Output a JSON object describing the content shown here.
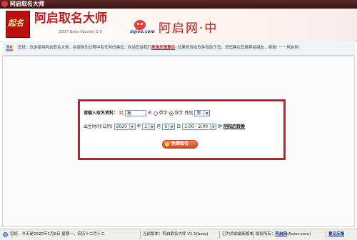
{
  "window": {
    "title": "阿启取名大师"
  },
  "banner": {
    "logo_text": "起名",
    "brand_title": "阿启取名大师",
    "version": "2007 Beta Version 1.0",
    "site_logo_text": "aqioo.com",
    "site_name": "阿启网·中"
  },
  "welcome": {
    "text": "您好，欢迎使用阿启取名大师，在使用的过程中有任何的建议，欢迎您给我们",
    "link": "来信反馈意见",
    "text_after": "! 如果觉得本软件有助于您，请您建议您推荐给朋友，谢谢! 一一阿启网"
  },
  "form": {
    "prompt": "请输入取名资料：",
    "surname_label": "姓",
    "surname_value": "杨",
    "name_label": "名",
    "single_char": "单字",
    "double_char": "双字",
    "gender_label": "性别",
    "gender_value": "男",
    "birth_label": "出生时间(公历)",
    "year": "2020",
    "year_unit": "年",
    "month": "1",
    "month_unit": "月",
    "day": "6",
    "day_unit": "日",
    "hour": "1:00 - 2:00",
    "hour_unit": "时",
    "converter": "阴阳历转换",
    "submit": "免费取名"
  },
  "status": {
    "date": "您好，今天是2020年1月6日  星期一，农历十二月十二",
    "version": "当前版本：阿启取名大师 V1.0(beta)",
    "latest": "已为目前最新版本",
    "copyright_label": "版权所有：",
    "copyright_link": "阿启网",
    "site": "(Aqioo.com)",
    "feedback": "意见反馈"
  }
}
